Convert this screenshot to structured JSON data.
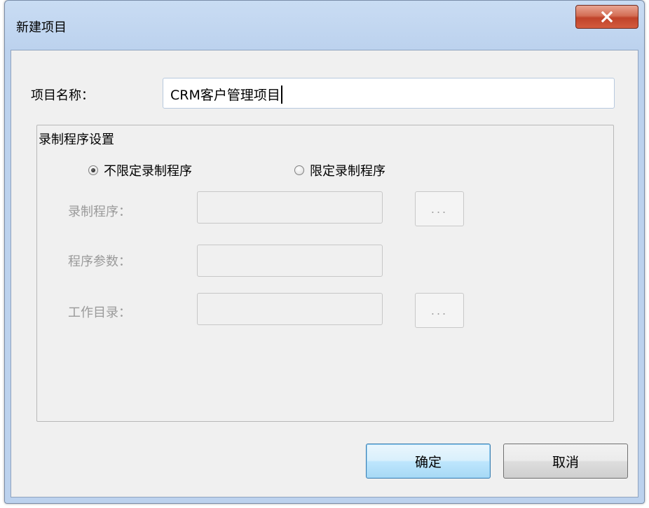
{
  "window": {
    "title": "新建项目",
    "close_label": "x"
  },
  "project_name": {
    "label": "项目名称：",
    "value": "CRM客户管理项目"
  },
  "record_settings": {
    "group_title": "录制程序设置",
    "radio_unrestricted": {
      "label": "不限定录制程序",
      "checked": true
    },
    "radio_restricted": {
      "label": "限定录制程序",
      "checked": false
    },
    "program_label": "录制程序：",
    "program_value": "",
    "params_label": "程序参数：",
    "params_value": "",
    "workdir_label": "工作目录：",
    "workdir_value": "",
    "browse_label": "..."
  },
  "buttons": {
    "ok": "确定",
    "cancel": "取消"
  },
  "colors": {
    "title_bar": "#bcd2ee",
    "close_button": "#c0432a",
    "dialog_bg": "#f0f0f0",
    "disabled_text": "#9a9a9a",
    "default_button": "#bee6fd"
  }
}
